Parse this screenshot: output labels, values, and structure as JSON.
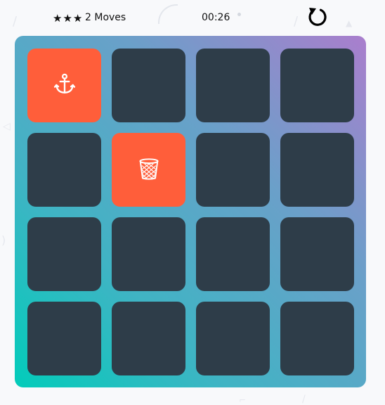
{
  "score_panel": {
    "stars": "★★★",
    "moves_count": "2",
    "moves_label": "Moves",
    "timer": "00:26",
    "restart_icon": "restart-icon"
  },
  "deck": {
    "rows": 4,
    "cols": 4,
    "cards": [
      {
        "state": "open",
        "icon": "anchor-icon"
      },
      {
        "state": "closed",
        "icon": ""
      },
      {
        "state": "closed",
        "icon": ""
      },
      {
        "state": "closed",
        "icon": ""
      },
      {
        "state": "closed",
        "icon": ""
      },
      {
        "state": "open",
        "icon": "trash-icon"
      },
      {
        "state": "closed",
        "icon": ""
      },
      {
        "state": "closed",
        "icon": ""
      },
      {
        "state": "closed",
        "icon": ""
      },
      {
        "state": "closed",
        "icon": ""
      },
      {
        "state": "closed",
        "icon": ""
      },
      {
        "state": "closed",
        "icon": ""
      },
      {
        "state": "closed",
        "icon": ""
      },
      {
        "state": "closed",
        "icon": ""
      },
      {
        "state": "closed",
        "icon": ""
      },
      {
        "state": "closed",
        "icon": ""
      }
    ]
  },
  "colors": {
    "card_closed": "#2e3d49",
    "card_open": "#ff5e3a",
    "deck_gradient_start": "#aa7ecd",
    "deck_gradient_end": "#02ccba"
  }
}
